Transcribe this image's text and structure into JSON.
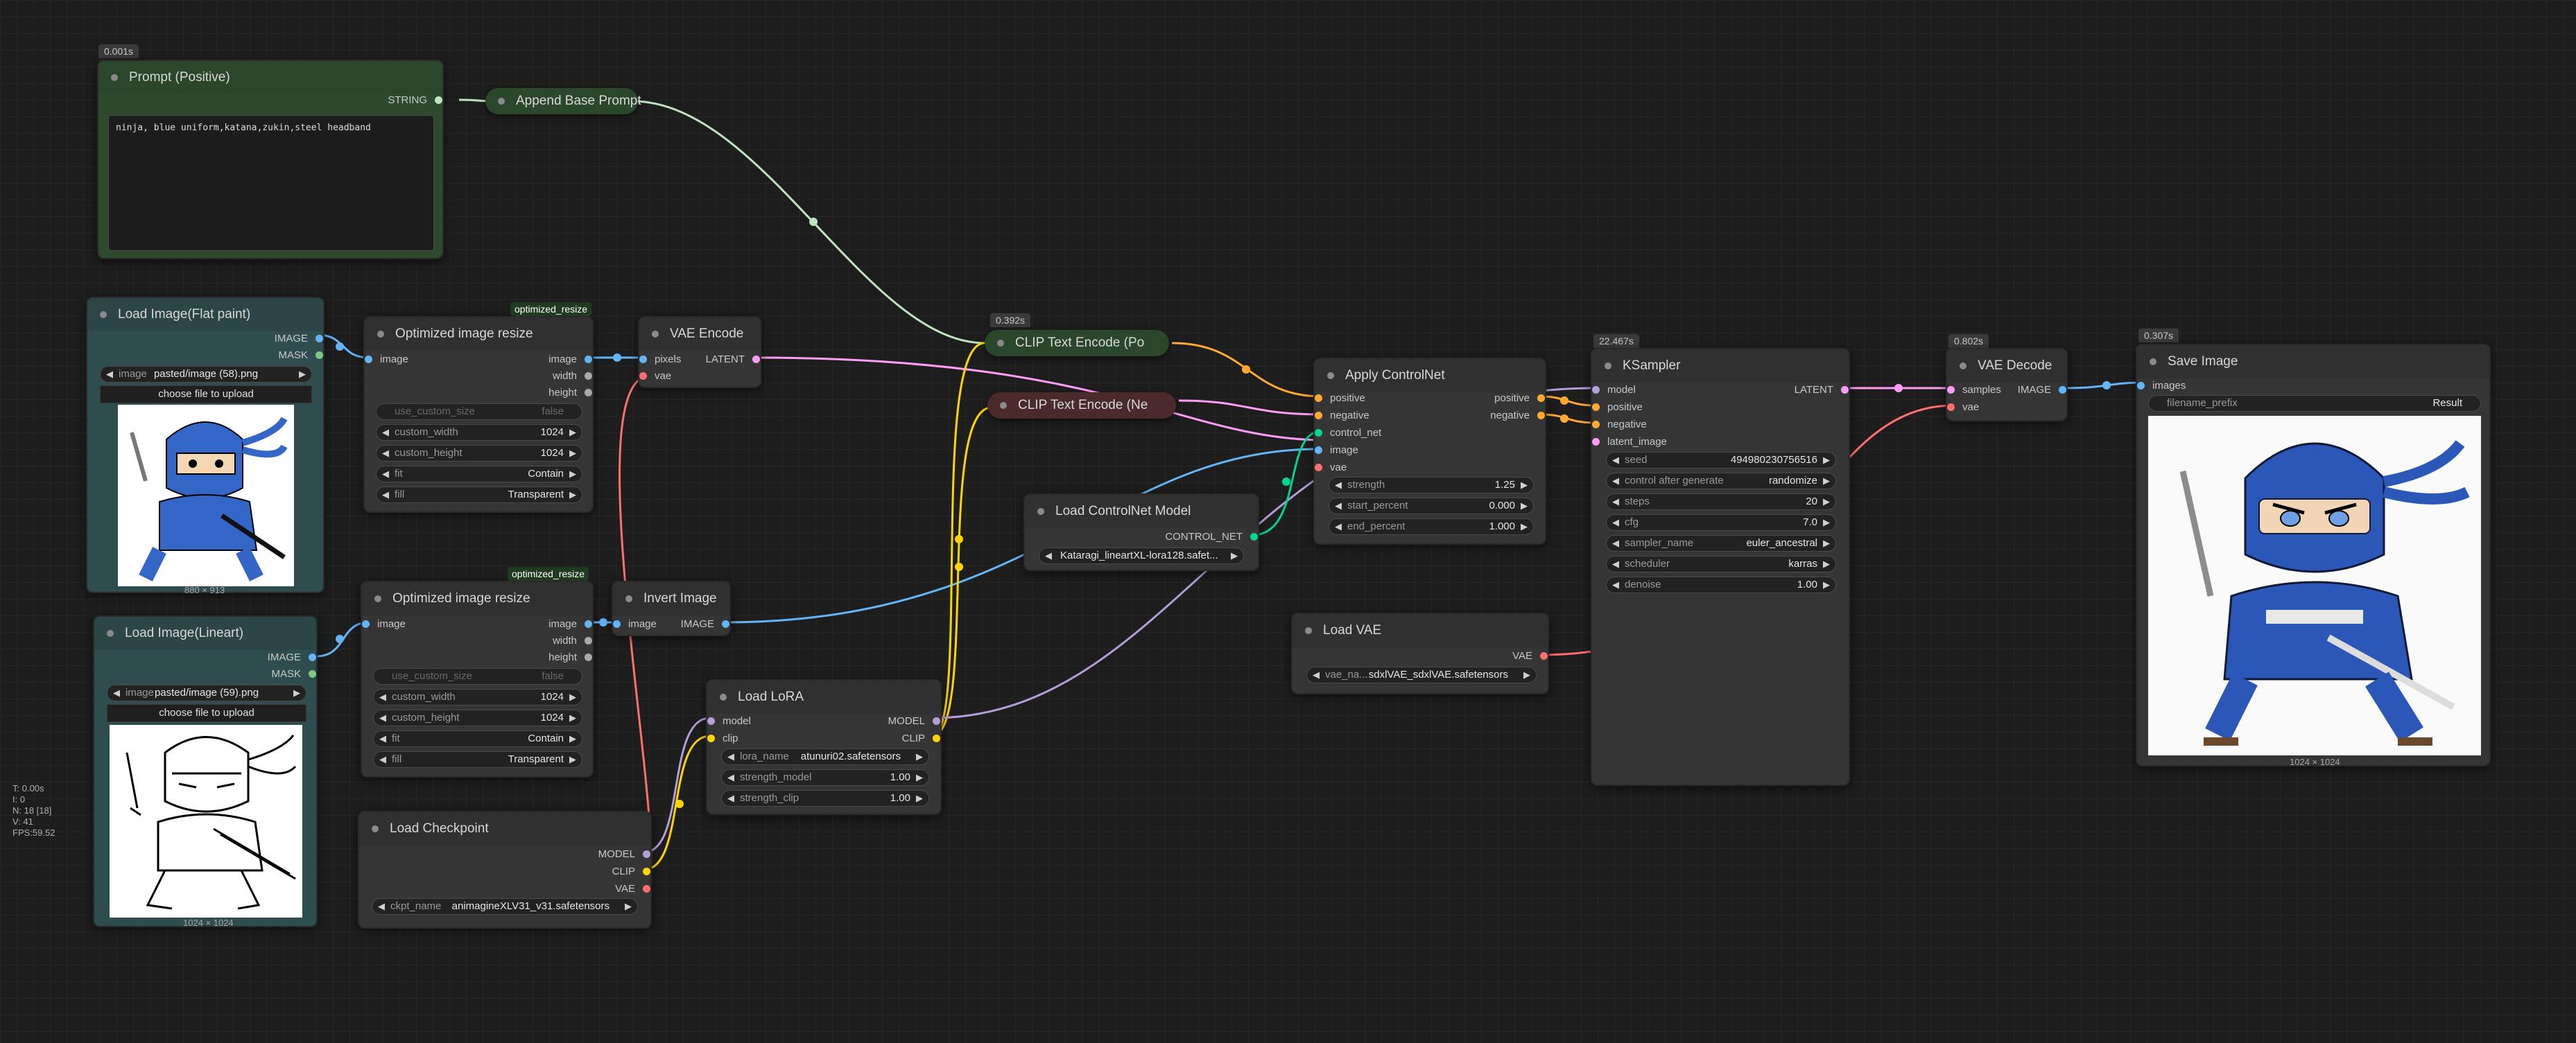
{
  "colors": {
    "image": "#64b5f6",
    "mask": "#81c784",
    "latent": "#ff9cf9",
    "string": "#bfe3be",
    "conditioning": "#ffa931",
    "model": "#b39ddb",
    "clip": "#ffd500",
    "vae": "#ff6e6e",
    "control_net": "#00d78d",
    "int": "#aaaaaa"
  },
  "nodes": {
    "prompt_positive": {
      "time": "0.001s",
      "title": "Prompt (Positive)",
      "out_string": "STRING",
      "text": "ninja, blue uniform,katana,zukin,steel headband"
    },
    "append_base_prompt": {
      "title": "Append Base Prompt"
    },
    "load_image_flat": {
      "title": "Load Image(Flat paint)",
      "out_image": "IMAGE",
      "out_mask": "MASK",
      "widget_label": "image",
      "widget_value": "pasted/image (58).png",
      "button": "choose file to upload",
      "caption": "880 × 913"
    },
    "opt_resize_1": {
      "tag": "optimized_resize",
      "title": "Optimized image resize",
      "in_image": "image",
      "out_image": "image",
      "out_width": "width",
      "out_height": "height",
      "w1_label": "use_custom_size",
      "w1_value": "false",
      "w2_label": "custom_width",
      "w2_value": "1024",
      "w3_label": "custom_height",
      "w3_value": "1024",
      "w4_label": "fit",
      "w4_value": "Contain",
      "w5_label": "fill",
      "w5_value": "Transparent"
    },
    "vae_encode": {
      "title": "VAE Encode",
      "in_pixels": "pixels",
      "in_vae": "vae",
      "out_latent": "LATENT"
    },
    "load_image_lineart": {
      "title": "Load Image(Lineart)",
      "out_image": "IMAGE",
      "out_mask": "MASK",
      "widget_label": "image",
      "widget_value": "pasted/image (59).png",
      "button": "choose file to upload",
      "caption": "1024 × 1024"
    },
    "opt_resize_2": {
      "tag": "optimized_resize",
      "title": "Optimized image resize",
      "in_image": "image",
      "out_image": "image",
      "out_width": "width",
      "out_height": "height",
      "w1_label": "use_custom_size",
      "w1_value": "false",
      "w2_label": "custom_width",
      "w2_value": "1024",
      "w3_label": "custom_height",
      "w3_value": "1024",
      "w4_label": "fit",
      "w4_value": "Contain",
      "w5_label": "fill",
      "w5_value": "Transparent"
    },
    "invert_image": {
      "title": "Invert Image",
      "in_image": "image",
      "out_image": "IMAGE"
    },
    "load_checkpoint": {
      "title": "Load Checkpoint",
      "out_model": "MODEL",
      "out_clip": "CLIP",
      "out_vae": "VAE",
      "widget_label": "ckpt_name",
      "widget_value": "animagineXLV31_v31.safetensors"
    },
    "load_lora": {
      "title": "Load LoRA",
      "in_model": "model",
      "in_clip": "clip",
      "out_model": "MODEL",
      "out_clip": "CLIP",
      "w1_label": "lora_name",
      "w1_value": "atunuri02.safetensors",
      "w2_label": "strength_model",
      "w2_value": "1.00",
      "w3_label": "strength_clip",
      "w3_value": "1.00"
    },
    "clip_pos": {
      "time": "0.392s",
      "title": "CLIP Text Encode (Po"
    },
    "clip_neg": {
      "title": "CLIP Text Encode (Ne"
    },
    "load_controlnet": {
      "title": "Load ControlNet Model",
      "out": "CONTROL_NET",
      "widget_value": "Kataragi_lineartXL-lora128.safet..."
    },
    "apply_controlnet": {
      "title": "Apply ControlNet",
      "in_positive": "positive",
      "in_negative": "negative",
      "in_control_net": "control_net",
      "in_image": "image",
      "in_vae": "vae",
      "out_positive": "positive",
      "out_negative": "negative",
      "w1_label": "strength",
      "w1_value": "1.25",
      "w2_label": "start_percent",
      "w2_value": "0.000",
      "w3_label": "end_percent",
      "w3_value": "1.000"
    },
    "load_vae": {
      "title": "Load VAE",
      "out_vae": "VAE",
      "widget_label": "vae_na...",
      "widget_value": "sdxlVAE_sdxlVAE.safetensors"
    },
    "ksampler": {
      "time": "22.467s",
      "title": "KSampler",
      "in_model": "model",
      "in_positive": "positive",
      "in_negative": "negative",
      "in_latent": "latent_image",
      "out_latent": "LATENT",
      "w1_label": "seed",
      "w1_value": "494980230756516",
      "w2_label": "control after generate",
      "w2_value": "randomize",
      "w3_label": "steps",
      "w3_value": "20",
      "w4_label": "cfg",
      "w4_value": "7.0",
      "w5_label": "sampler_name",
      "w5_value": "euler_ancestral",
      "w6_label": "scheduler",
      "w6_value": "karras",
      "w7_label": "denoise",
      "w7_value": "1.00"
    },
    "vae_decode": {
      "time": "0.802s",
      "title": "VAE Decode",
      "in_samples": "samples",
      "in_vae": "vae",
      "out_image": "IMAGE"
    },
    "save_image": {
      "time": "0.307s",
      "title": "Save Image",
      "in_images": "images",
      "widget_label": "filename_prefix",
      "widget_value": "Result",
      "caption": "1024 × 1024"
    }
  },
  "stats": [
    "T: 0.00s",
    "I: 0",
    "N: 18 [18]",
    "V: 41",
    "FPS:59.52"
  ]
}
